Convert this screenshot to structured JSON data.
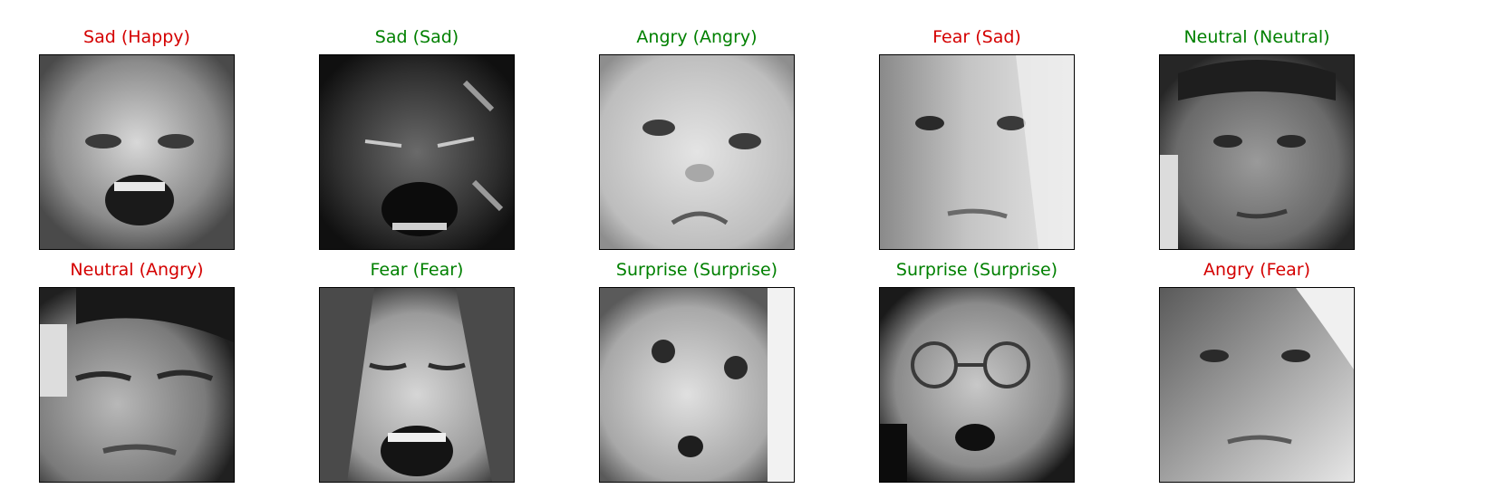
{
  "colors": {
    "correct": "#008000",
    "incorrect": "#d40000",
    "frame": "#000000"
  },
  "panels": [
    {
      "label": "Sad (Happy)",
      "status": "incorrect"
    },
    {
      "label": "Sad (Sad)",
      "status": "correct"
    },
    {
      "label": "Angry (Angry)",
      "status": "correct"
    },
    {
      "label": "Fear (Sad)",
      "status": "incorrect"
    },
    {
      "label": "Neutral (Neutral)",
      "status": "correct"
    },
    {
      "label": "Neutral (Angry)",
      "status": "incorrect"
    },
    {
      "label": "Fear (Fear)",
      "status": "correct"
    },
    {
      "label": "Surprise (Surprise)",
      "status": "correct"
    },
    {
      "label": "Surprise (Surprise)",
      "status": "correct"
    },
    {
      "label": "Angry (Fear)",
      "status": "incorrect"
    }
  ]
}
